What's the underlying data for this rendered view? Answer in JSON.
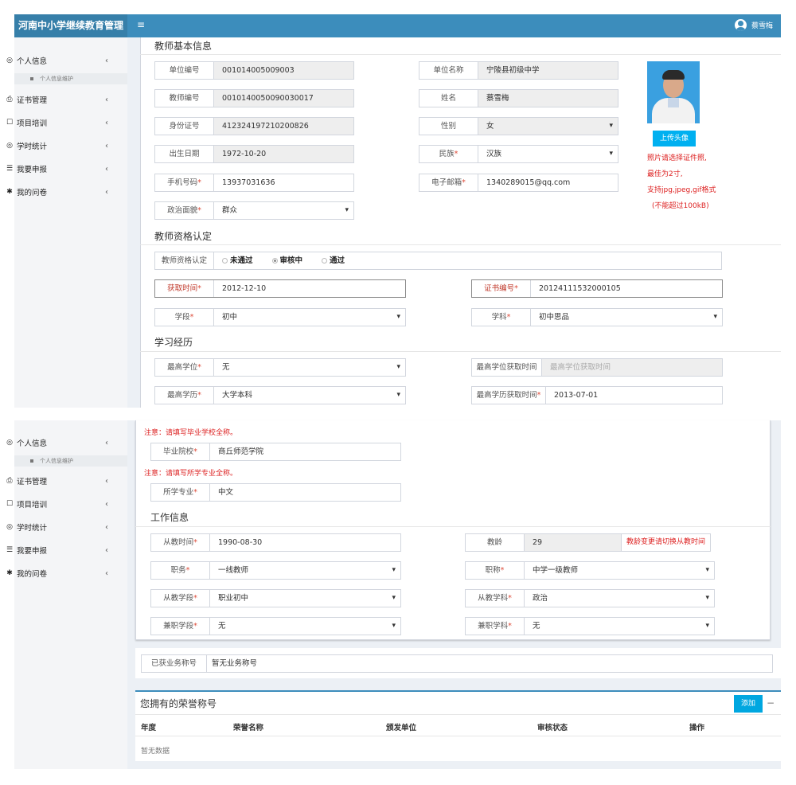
{
  "app_title": "河南中小学继续教育管理",
  "menu_toggle_icon": "≡",
  "user_name": "蔡雪梅",
  "sidebar": {
    "items": [
      {
        "label": "个人信息",
        "icon": "◎",
        "chevron": "‹"
      },
      {
        "label": "证书管理",
        "icon": "⎙",
        "chevron": "‹"
      },
      {
        "label": "项目培训",
        "icon": "☐",
        "chevron": "‹"
      },
      {
        "label": "学时统计",
        "icon": "◎",
        "chevron": "‹"
      },
      {
        "label": "我要申报",
        "icon": "☰",
        "chevron": "‹"
      },
      {
        "label": "我的问卷",
        "icon": "✱",
        "chevron": "‹"
      }
    ],
    "sub_item": "个人信息维护"
  },
  "basic": {
    "title": "教师基本信息",
    "unit_code": {
      "label": "单位编号",
      "value": "001014005009003"
    },
    "unit_name": {
      "label": "单位名称",
      "value": "宁陵县初级中学"
    },
    "teacher_no": {
      "label": "教师编号",
      "value": "0010140050090030017"
    },
    "name": {
      "label": "姓名",
      "value": "蔡雪梅"
    },
    "id_no": {
      "label": "身份证号",
      "value": "412324197210200826"
    },
    "gender": {
      "label": "性别",
      "value": "女"
    },
    "birth": {
      "label": "出生日期",
      "value": "1972-10-20"
    },
    "ethnic": {
      "label": "民族",
      "value": "汉族"
    },
    "phone": {
      "label": "手机号码",
      "value": "13937031636"
    },
    "email": {
      "label": "电子邮箱",
      "value": "1340289015@qq.com"
    },
    "politics": {
      "label": "政治面貌",
      "value": "群众"
    },
    "upload_btn": "上传头像",
    "photo_notes": [
      "照片请选择证件照,",
      "最佳为2寸,",
      "支持jpg,jpeg,gif格式",
      "(不能超过100kB)"
    ]
  },
  "qual": {
    "title": "教师资格认定",
    "label": "教师资格认定",
    "options": [
      "未通过",
      "审核中",
      "通过"
    ],
    "selected": "审核中",
    "get_time": {
      "label": "获取时间",
      "value": "2012-12-10"
    },
    "cert_no": {
      "label": "证书编号",
      "value": "20124111532000105"
    },
    "stage": {
      "label": "学段",
      "value": "初中"
    },
    "subject": {
      "label": "学科",
      "value": "初中思品"
    }
  },
  "study": {
    "title": "学习经历",
    "degree": {
      "label": "最高学位",
      "value": "无"
    },
    "degree_time": {
      "label": "最高学位获取时间",
      "placeholder": "最高学位获取时间"
    },
    "edu": {
      "label": "最高学历",
      "value": "大学本科"
    },
    "edu_time": {
      "label": "最高学历获取时间",
      "value": "2013-07-01"
    },
    "school_note": "注意：请填写毕业学校全称。",
    "school": {
      "label": "毕业院校",
      "value": "商丘师范学院"
    },
    "major_note": "注意：请填写所学专业全称。",
    "major": {
      "label": "所学专业",
      "value": "中文"
    }
  },
  "work": {
    "title": "工作信息",
    "start": {
      "label": "从教时间",
      "value": "1990-08-30"
    },
    "years": {
      "label": "教龄",
      "value": "29"
    },
    "years_btn": "教龄变更请切换从教时间",
    "duty": {
      "label": "职务",
      "value": "一线教师"
    },
    "rank": {
      "label": "职称",
      "value": "中学一级教师"
    },
    "teach_stage": {
      "label": "从教学段",
      "value": "职业初中"
    },
    "teach_subject": {
      "label": "从教学科",
      "value": "政治"
    },
    "part_stage": {
      "label": "兼职学段",
      "value": "无"
    },
    "part_subject": {
      "label": "兼职学科",
      "value": "无"
    }
  },
  "business": {
    "label": "已获业务称号",
    "value": "暂无业务称号"
  },
  "honor": {
    "title": "您拥有的荣誉称号",
    "add_btn": "添加",
    "collapse": "−",
    "columns": [
      "年度",
      "荣誉名称",
      "颁发单位",
      "审核状态",
      "操作"
    ],
    "empty": "暂无数据"
  },
  "colors": {
    "header": "#3c8dbc",
    "logo_bg": "#367fa9",
    "required": "#dd4b39",
    "add_button": "#00a7e0"
  }
}
